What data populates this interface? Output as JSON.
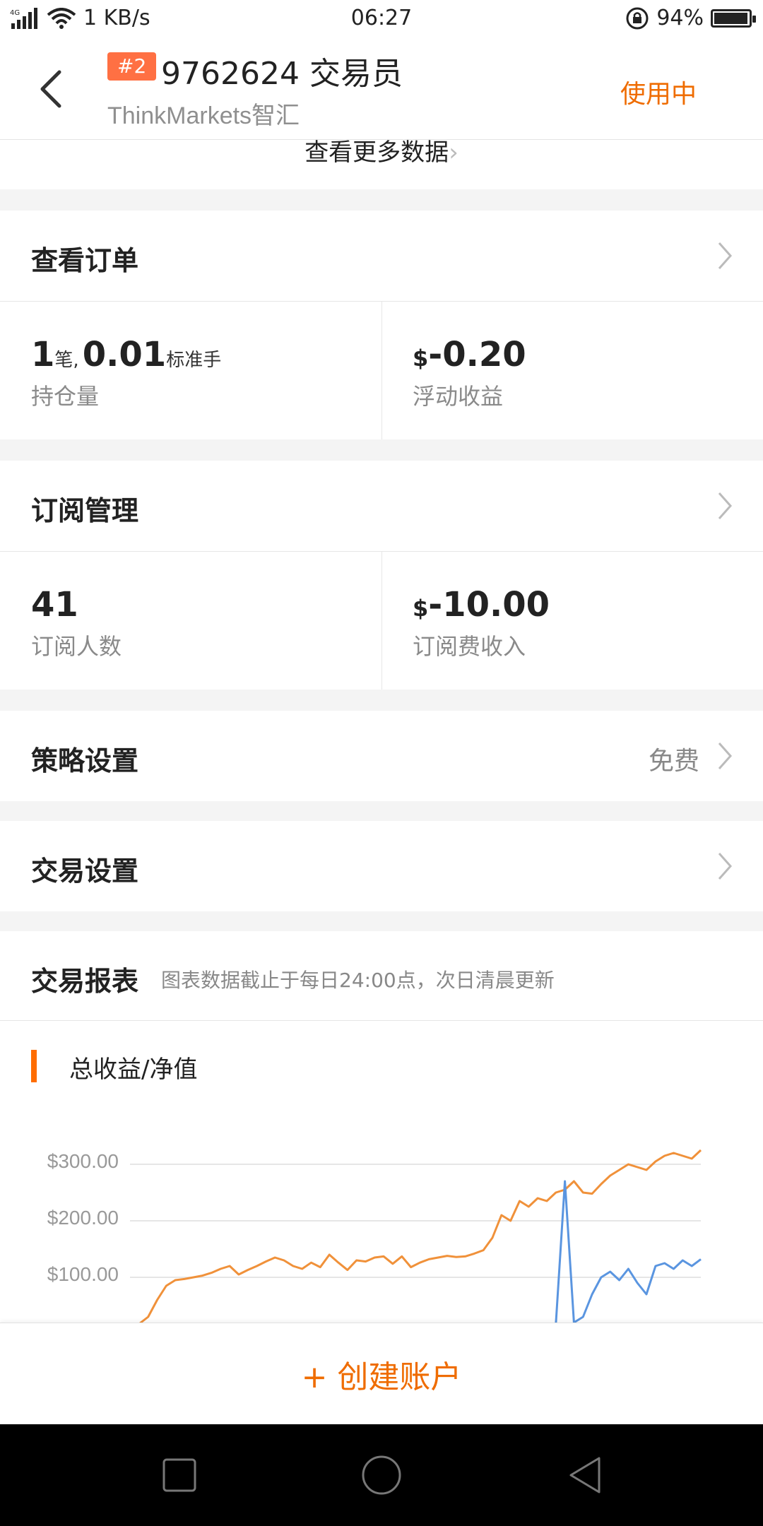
{
  "status_bar": {
    "network": "4G",
    "speed": "1 KB/s",
    "time": "06:27",
    "battery": "94%",
    "battery_level": 0.94
  },
  "header": {
    "rank_badge": "#2",
    "account_title": "9762624 交易员",
    "broker": "ThinkMarkets智汇",
    "status": "使用中"
  },
  "more_data": {
    "label": "查看更多数据"
  },
  "orders": {
    "title": "查看订单",
    "position_count": "1",
    "position_count_unit": "笔,",
    "lots": "0.01",
    "lots_unit": "标准手",
    "position_label": "持仓量",
    "currency": "$",
    "floating_pnl": "-0.20",
    "floating_pnl_label": "浮动收益"
  },
  "subscriptions": {
    "title": "订阅管理",
    "subscriber_count": "41",
    "subscriber_label": "订阅人数",
    "currency": "$",
    "fee_income": "-10.00",
    "fee_income_label": "订阅费收入"
  },
  "strategy": {
    "title": "策略设置",
    "value": "免费"
  },
  "trade_settings": {
    "title": "交易设置"
  },
  "report": {
    "title": "交易报表",
    "note": "图表数据截止于每日24:00点，次日清晨更新",
    "chart_title": "总收益/净值"
  },
  "chart_data": {
    "type": "line",
    "title": "总收益/净值",
    "y_ticks": [
      "$300.00",
      "$200.00",
      "$100.00"
    ],
    "y_tick_values": [
      300,
      200,
      100
    ],
    "ylim": [
      0,
      340
    ],
    "colors": {
      "total_profit": "#f0913a",
      "equity": "#5a95e0"
    },
    "series": [
      {
        "values": [
          -20,
          5,
          30,
          60,
          85,
          95,
          97,
          100,
          103,
          108,
          115,
          120,
          105,
          113,
          120,
          128,
          135,
          130,
          120,
          115,
          126,
          118,
          140,
          126,
          113,
          130,
          128,
          135,
          137,
          124,
          137,
          118,
          126,
          132,
          135,
          138,
          136,
          137,
          142,
          148,
          170,
          210,
          200,
          235,
          225,
          240,
          235,
          250,
          255,
          270,
          250,
          248,
          265,
          280,
          290,
          300,
          295,
          290,
          305,
          315,
          320,
          315,
          310,
          325
        ]
      },
      {
        "values": [
          -20,
          -20,
          -20,
          -20,
          -20,
          -20,
          -20,
          -20,
          -20,
          -20,
          -20,
          -20,
          -20,
          -20,
          -20,
          -20,
          -20,
          -20,
          -20,
          -20,
          -20,
          -20,
          -20,
          -20,
          -20,
          -20,
          -20,
          -20,
          -20,
          -20,
          -20,
          -20,
          -20,
          -20,
          -20,
          -20,
          -20,
          -20,
          -20,
          -20,
          -20,
          -20,
          -20,
          -20,
          -20,
          -20,
          -20,
          -20,
          270,
          20,
          30,
          70,
          100,
          110,
          95,
          115,
          90,
          70,
          120,
          125,
          115,
          130,
          120,
          132
        ]
      }
    ]
  },
  "create_account": {
    "label": "+ 创建账户"
  }
}
